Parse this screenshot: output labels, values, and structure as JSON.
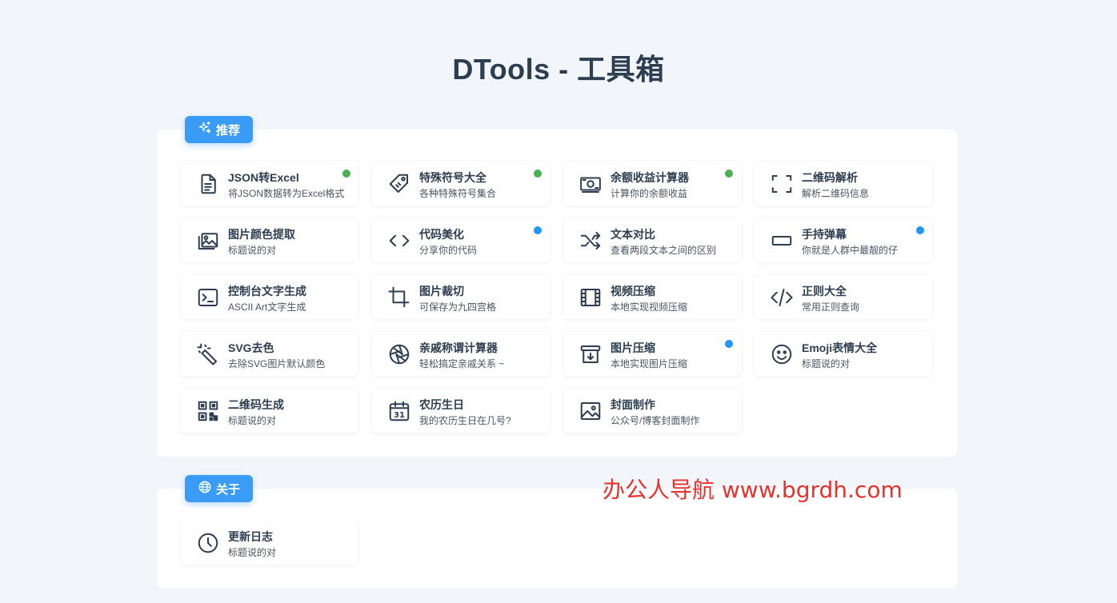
{
  "page": {
    "title": "DTools - 工具箱"
  },
  "colors": {
    "green": "#4caf50",
    "blue": "#2196f3",
    "accent": "#3b9cf7",
    "watermark": "#e8322d"
  },
  "sections": {
    "recommend": {
      "label": "推荐",
      "icon": "sparkles-icon",
      "tools": [
        {
          "title": "JSON转Excel",
          "desc": "将JSON数据转为Excel格式",
          "icon": "file-text-icon",
          "dot": "green"
        },
        {
          "title": "特殊符号大全",
          "desc": "各种特殊符号集合",
          "icon": "tag-icon",
          "dot": "green"
        },
        {
          "title": "余额收益计算器",
          "desc": "计算你的余额收益",
          "icon": "cash-icon",
          "dot": "green"
        },
        {
          "title": "二维码解析",
          "desc": "解析二维码信息",
          "icon": "scan-icon",
          "dot": ""
        },
        {
          "title": "图片颜色提取",
          "desc": "标题说的对",
          "icon": "images-icon",
          "dot": ""
        },
        {
          "title": "代码美化",
          "desc": "分享你的代码",
          "icon": "code-icon",
          "dot": "blue"
        },
        {
          "title": "文本对比",
          "desc": "查看两段文本之间的区别",
          "icon": "shuffle-icon",
          "dot": ""
        },
        {
          "title": "手持弹幕",
          "desc": "你就是人群中最靓的仔",
          "icon": "rectangle-icon",
          "dot": "blue"
        },
        {
          "title": "控制台文字生成",
          "desc": "ASCII Art文字生成",
          "icon": "terminal-icon",
          "dot": ""
        },
        {
          "title": "图片裁切",
          "desc": "可保存为九四宫格",
          "icon": "crop-icon",
          "dot": ""
        },
        {
          "title": "视频压缩",
          "desc": "本地实现视频压缩",
          "icon": "film-icon",
          "dot": ""
        },
        {
          "title": "正则大全",
          "desc": "常用正则查询",
          "icon": "code-slash-icon",
          "dot": ""
        },
        {
          "title": "SVG去色",
          "desc": "去除SVG图片默认颜色",
          "icon": "magic-wand-icon",
          "dot": ""
        },
        {
          "title": "亲戚称谓计算器",
          "desc": "轻松搞定亲戚关系 ~",
          "icon": "aperture-icon",
          "dot": ""
        },
        {
          "title": "图片压缩",
          "desc": "本地实现图片压缩",
          "icon": "archive-icon",
          "dot": "blue"
        },
        {
          "title": "Emoji表情大全",
          "desc": "标题说的对",
          "icon": "smile-icon",
          "dot": ""
        },
        {
          "title": "二维码生成",
          "desc": "标题说的对",
          "icon": "qrcode-icon",
          "dot": ""
        },
        {
          "title": "农历生日",
          "desc": "我的农历生日在几号?",
          "icon": "calendar-icon",
          "dot": ""
        },
        {
          "title": "封面制作",
          "desc": "公众号/博客封面制作",
          "icon": "image-icon",
          "dot": ""
        }
      ]
    },
    "about": {
      "label": "关于",
      "icon": "globe-icon",
      "tools": [
        {
          "title": "更新日志",
          "desc": "标题说的对",
          "icon": "clock-icon",
          "dot": ""
        }
      ]
    }
  },
  "watermark": "办公人导航  www.bgrdh.com"
}
